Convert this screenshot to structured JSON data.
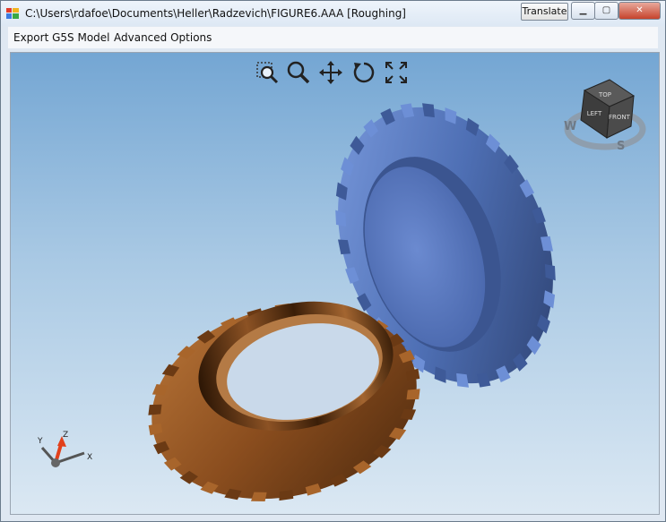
{
  "window": {
    "title": "C:\\Users\\rdafoe\\Documents\\Heller\\Radzevich\\FIGURE6.AAA [Roughing]",
    "translate_label": "Translate",
    "minimize_symbol": "▁",
    "maximize_symbol": "▢",
    "close_symbol": "✕"
  },
  "menu": {
    "items": [
      {
        "label": "Export G5S Model"
      },
      {
        "label": "Advanced Options"
      }
    ]
  },
  "toolbar": {
    "icons": [
      "zoom-window-icon",
      "zoom-icon",
      "pan-icon",
      "rotate-icon",
      "fit-view-icon"
    ]
  },
  "view_cube": {
    "faces": {
      "top": "TOP",
      "front": "FRONT",
      "left": "LEFT"
    },
    "compass": {
      "west": "W",
      "south": "S"
    }
  },
  "axis_triad": {
    "x": "X",
    "y": "Y",
    "z": "Z"
  },
  "colors": {
    "background_top": "#74a6d3",
    "background_bottom": "#dbe8f3",
    "blue_gear": "#5b7fc0",
    "bronze_gear": "#8a4d1e",
    "z_axis": "#e2401b"
  }
}
